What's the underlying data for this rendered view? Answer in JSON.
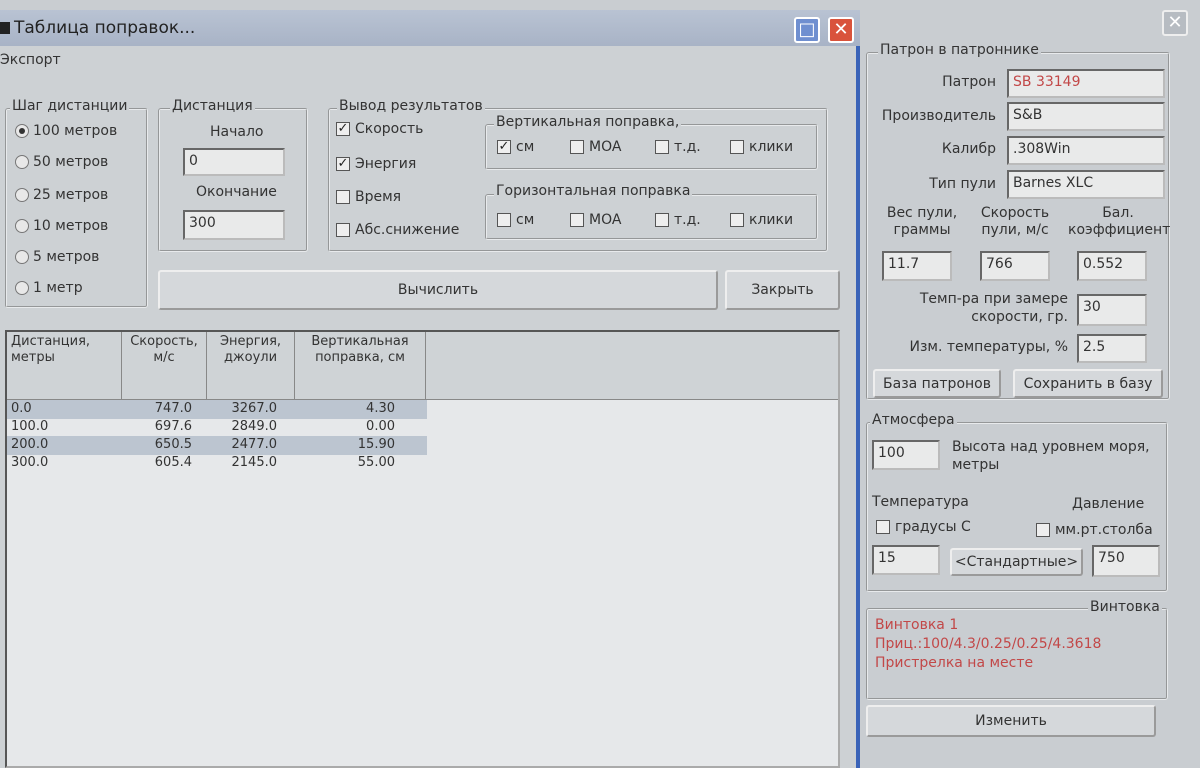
{
  "window": {
    "title": "Таблица поправок...",
    "menu": "Экспорт"
  },
  "step": {
    "title": "Шаг дистанции",
    "options": [
      "100 метров",
      "50 метров",
      "25 метров",
      "10 метров",
      "5 метров",
      "1 метр"
    ],
    "selected": 0
  },
  "distance": {
    "title": "Дистанция",
    "start_label": "Начало",
    "start": "0",
    "end_label": "Окончание",
    "end": "300"
  },
  "output": {
    "title": "Вывод результатов",
    "items": [
      {
        "label": "Скорость",
        "checked": true
      },
      {
        "label": "Энергия",
        "checked": true
      },
      {
        "label": "Время",
        "checked": false
      },
      {
        "label": "Абс.снижение",
        "checked": false
      }
    ],
    "vertical": {
      "title": "Вертикальная поправка,",
      "items": [
        {
          "label": "см",
          "checked": true
        },
        {
          "label": "MOA",
          "checked": false
        },
        {
          "label": "т.д.",
          "checked": false
        },
        {
          "label": "клики",
          "checked": false
        }
      ]
    },
    "horizontal": {
      "title": "Горизонтальная поправка",
      "items": [
        {
          "label": "см",
          "checked": false
        },
        {
          "label": "MOA",
          "checked": false
        },
        {
          "label": "т.д.",
          "checked": false
        },
        {
          "label": "клики",
          "checked": false
        }
      ]
    }
  },
  "buttons": {
    "calculate": "Вычислить",
    "close": "Закрыть"
  },
  "table": {
    "headers": [
      "Дистанция,\nметры",
      "Скорость,\nм/с",
      "Энергия,\nджоули",
      "Вертикальная\nпоправка, см"
    ],
    "rows": [
      [
        "0.0",
        "747.0",
        "3267.0",
        "4.30"
      ],
      [
        "100.0",
        "697.6",
        "2849.0",
        "0.00"
      ],
      [
        "200.0",
        "650.5",
        "2477.0",
        "15.90"
      ],
      [
        "300.0",
        "605.4",
        "2145.0",
        "55.00"
      ]
    ]
  },
  "cartridge": {
    "title": "Патрон в патроннике",
    "cartridge_label": "Патрон",
    "cartridge": "SB 33149",
    "maker_label": "Производитель",
    "maker": "S&B",
    "caliber_label": "Калибр",
    "caliber": ".308Win",
    "bullet_label": "Тип пули",
    "bullet": "Barnes XLC",
    "weight_label": "Вес пули,\nграммы",
    "weight": "11.7",
    "speed_label": "Скорость\nпули, м/с",
    "speed": "766",
    "bc_label": "Бал.\nкоэффициент",
    "bc": "0.552",
    "temp_label": "Темп-ра при замере\nскорости, гр.",
    "temp": "30",
    "temp_change_label": "Изм. температуры, %",
    "temp_change": "2.5",
    "db_button": "База патронов",
    "save_button": "Сохранить в базу"
  },
  "atmosphere": {
    "title": "Атмосфера",
    "altitude": "100",
    "altitude_label": "Высота над уровнем моря,\nметры",
    "temp_title": "Температура",
    "pressure_title": "Давление",
    "celsius_label": "градусы С",
    "mmhg_label": "мм.рт.столба",
    "temperature": "15",
    "standard_button": "<Стандартные>",
    "pressure": "750"
  },
  "rifle": {
    "title": "Винтовка",
    "lines": [
      "Винтовка 1",
      "Приц.:100/4.3/0.25/0.25/4.3618",
      "Пристрелка на месте"
    ],
    "change_button": "Изменить"
  },
  "colors": {
    "accent": "#3a63b8",
    "red_text": "#c24848"
  }
}
